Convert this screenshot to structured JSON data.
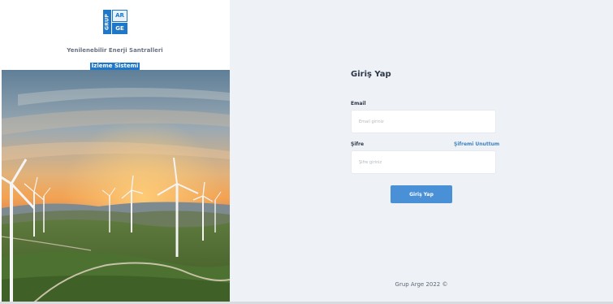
{
  "brand": {
    "logo_vertical": "GRUP",
    "logo_top": "AR",
    "logo_bottom": "GE",
    "subtitle": "Yenilenebilir Enerji Santralleri",
    "subtitle_highlight": "İzleme Sistemi",
    "primary_color": "#1f77c9"
  },
  "login": {
    "title": "Giriş Yap",
    "email_label": "Email",
    "email_placeholder": "Email giriniz",
    "password_label": "Şifre",
    "password_placeholder": "Şifre giriniz",
    "forgot_link": "Şifremi Unuttum",
    "submit_label": "Giriş Yap",
    "button_color": "#4a90d6"
  },
  "footer": {
    "text": "Grup Arge 2022 ©"
  }
}
